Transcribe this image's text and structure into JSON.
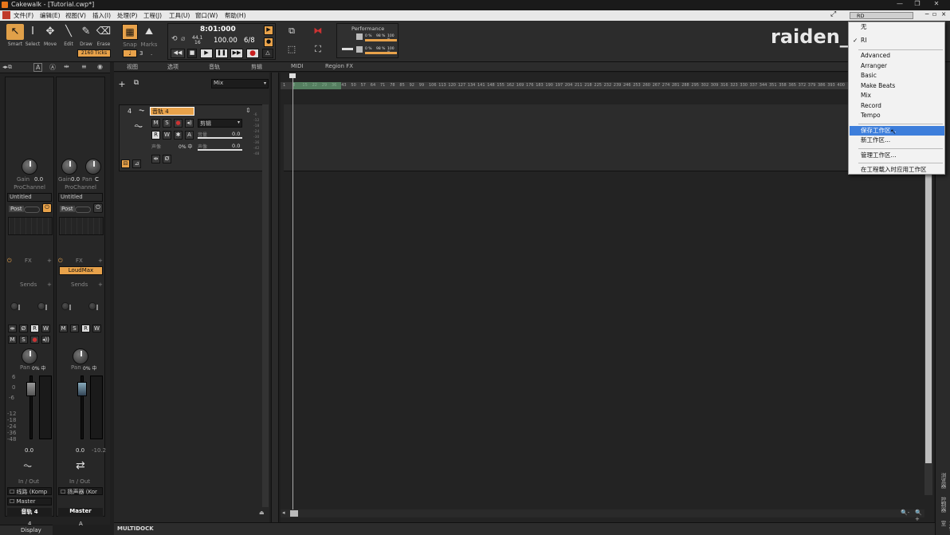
{
  "title": "Cakewalk - [Tutorial.cwp*]",
  "menu": [
    "文件(F)",
    "编辑(E)",
    "视图(V)",
    "插入(I)",
    "处理(P)",
    "工程(J)",
    "工具(U)",
    "窗口(W)",
    "帮助(H)"
  ],
  "tools": [
    {
      "label": "Smart",
      "icon": "↖"
    },
    {
      "label": "Select",
      "icon": "I"
    },
    {
      "label": "Move",
      "icon": "✥"
    },
    {
      "label": "Edit",
      "icon": "╲"
    },
    {
      "label": "Draw",
      "icon": "✎"
    },
    {
      "label": "Erase",
      "icon": "⌫"
    }
  ],
  "ticks_label": "2160 Ticks",
  "snap": {
    "label": "Snap",
    "value": "3",
    "dot": "."
  },
  "marks_label": "Marks",
  "transport": {
    "time": "8:01:000",
    "sample_rate": "44.1",
    "bits": "16",
    "tempo": "100.00",
    "meter": "6/8"
  },
  "performance_label": "Performance",
  "perf_rows": [
    [
      "0 %",
      "98 %",
      "100 %"
    ],
    [
      "0 %",
      "98 %",
      "100 %"
    ]
  ],
  "watermark": "raiden_p",
  "track_menus": [
    "视图",
    "选项",
    "音轨",
    "剪辑",
    "MIDI",
    "Region FX"
  ],
  "mix_dropdown": "Mix",
  "track": {
    "number": "4",
    "name": "音轨 4",
    "clip_label": "剪辑",
    "m": "M",
    "s": "S",
    "r": "R",
    "w": "W",
    "a": "A",
    "vol_label": "音量",
    "vol_val": "0.0",
    "pan_label": "声像",
    "pan_val": "0.0",
    "pct": "0% 中"
  },
  "meter_marks": [
    "-6",
    "-12",
    "-18",
    "-24",
    "-30",
    "-36",
    "-42",
    "-48"
  ],
  "ruler": [
    "1",
    "8",
    "15",
    "22",
    "29",
    "36",
    "43",
    "50",
    "57",
    "64",
    "71",
    "78",
    "85",
    "92",
    "99",
    "106",
    "113",
    "120",
    "127",
    "134",
    "141",
    "148",
    "155",
    "162",
    "169",
    "176",
    "183",
    "190",
    "197",
    "204",
    "211",
    "218",
    "225",
    "232",
    "239",
    "246",
    "253",
    "260",
    "267",
    "274",
    "281",
    "288",
    "295",
    "302",
    "309",
    "316",
    "323",
    "330",
    "337",
    "344",
    "351",
    "358",
    "365",
    "372",
    "379",
    "386",
    "393",
    "400"
  ],
  "strips": [
    {
      "gain": "Gain",
      "gain_val": "0.0",
      "prochannel": "ProChannel",
      "preset": "Untitled",
      "post": "Post",
      "fx": "FX",
      "plugin": "",
      "sends": "Sends",
      "pan": "Pan",
      "pan_val": "0% 中",
      "vol": "0.0",
      "io": "In / Out",
      "input": "☐ 线路 (Komp",
      "output": "☐ Master",
      "name": "音轨 4",
      "num": "4"
    },
    {
      "gain": "Gain",
      "gain_val": "0.0",
      "extra": "Pan",
      "extra_val": "C",
      "prochannel": "ProChannel",
      "preset": "Untitled",
      "post": "Post",
      "fx": "FX",
      "plugin": "LoudMax",
      "sends": "Sends",
      "pan": "Pan",
      "pan_val": "0% 中",
      "vol": "0.0",
      "vol_right": "-10.2",
      "io": "In / Out",
      "input": "☐ 扬声器 (Kor",
      "output": "",
      "name": "Master",
      "num": "A"
    }
  ],
  "fader_marks": [
    "6",
    "0",
    "-6",
    "-12",
    "-18",
    "-24",
    "-36",
    "-48"
  ],
  "display_label": "Display",
  "multidock": "MULTIDOCK",
  "workspace_current": "RD",
  "context_menu": {
    "items_top": [
      "无",
      "RI"
    ],
    "items_ws": [
      "Advanced",
      "Arranger",
      "Basic",
      "Make Beats",
      "Mix",
      "Record",
      "Tempo"
    ],
    "save": "保存工作区...",
    "new": "新工作区...",
    "manage": "管理工作区...",
    "apply": "在工程载入时应用工作区"
  },
  "right_tabs": [
    "浏览器",
    "控制器",
    "工作室"
  ]
}
